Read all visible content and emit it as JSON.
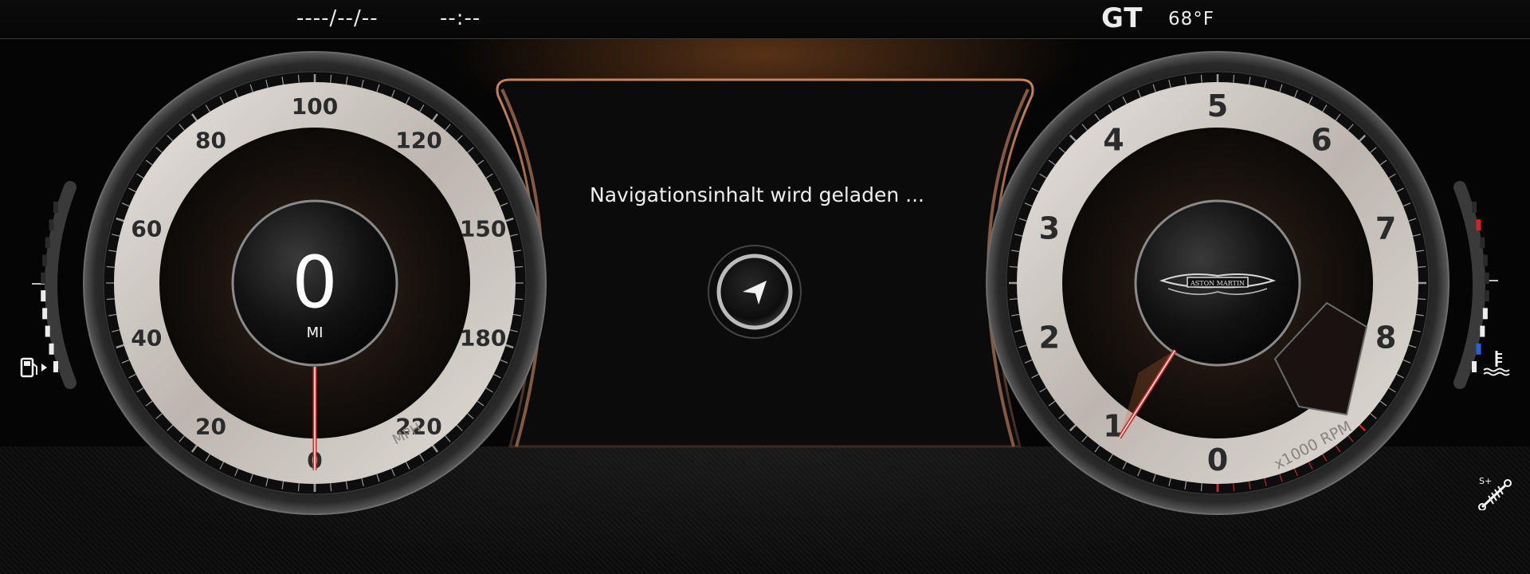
{
  "status_bar": {
    "date": "----/--/--",
    "time": "--:--",
    "drive_mode": "GT",
    "outside_temp": "68°F"
  },
  "speedometer": {
    "value": "0",
    "trip_unit": "MI",
    "unit": "MPH",
    "labels": [
      "0",
      "20",
      "40",
      "60",
      "80",
      "100",
      "120",
      "150",
      "180",
      "220"
    ],
    "needle_value": 0
  },
  "tachometer": {
    "labels": [
      "0",
      "1",
      "2",
      "3",
      "4",
      "5",
      "6",
      "7",
      "8"
    ],
    "unit": "x1000 RPM",
    "redline_from": 7,
    "needle_value": 0.9,
    "brand_badge": "ASTON MARTIN"
  },
  "navigation": {
    "message": "Navigationsinhalt wird geladen ...",
    "icon": "navigation-arrow-icon"
  },
  "fuel_gauge": {
    "icon": "fuel-pump-icon",
    "level": 0.45
  },
  "temperature_gauge": {
    "icon": "coolant-temperature-icon",
    "level": 0.4
  },
  "suspension_indicator": {
    "icon": "suspension-sport-plus-icon",
    "label": "S+"
  },
  "colors": {
    "accent": "#c8703a",
    "needle": "#d42a2a",
    "cold": "#2a5fd8",
    "hot": "#d2232a"
  }
}
